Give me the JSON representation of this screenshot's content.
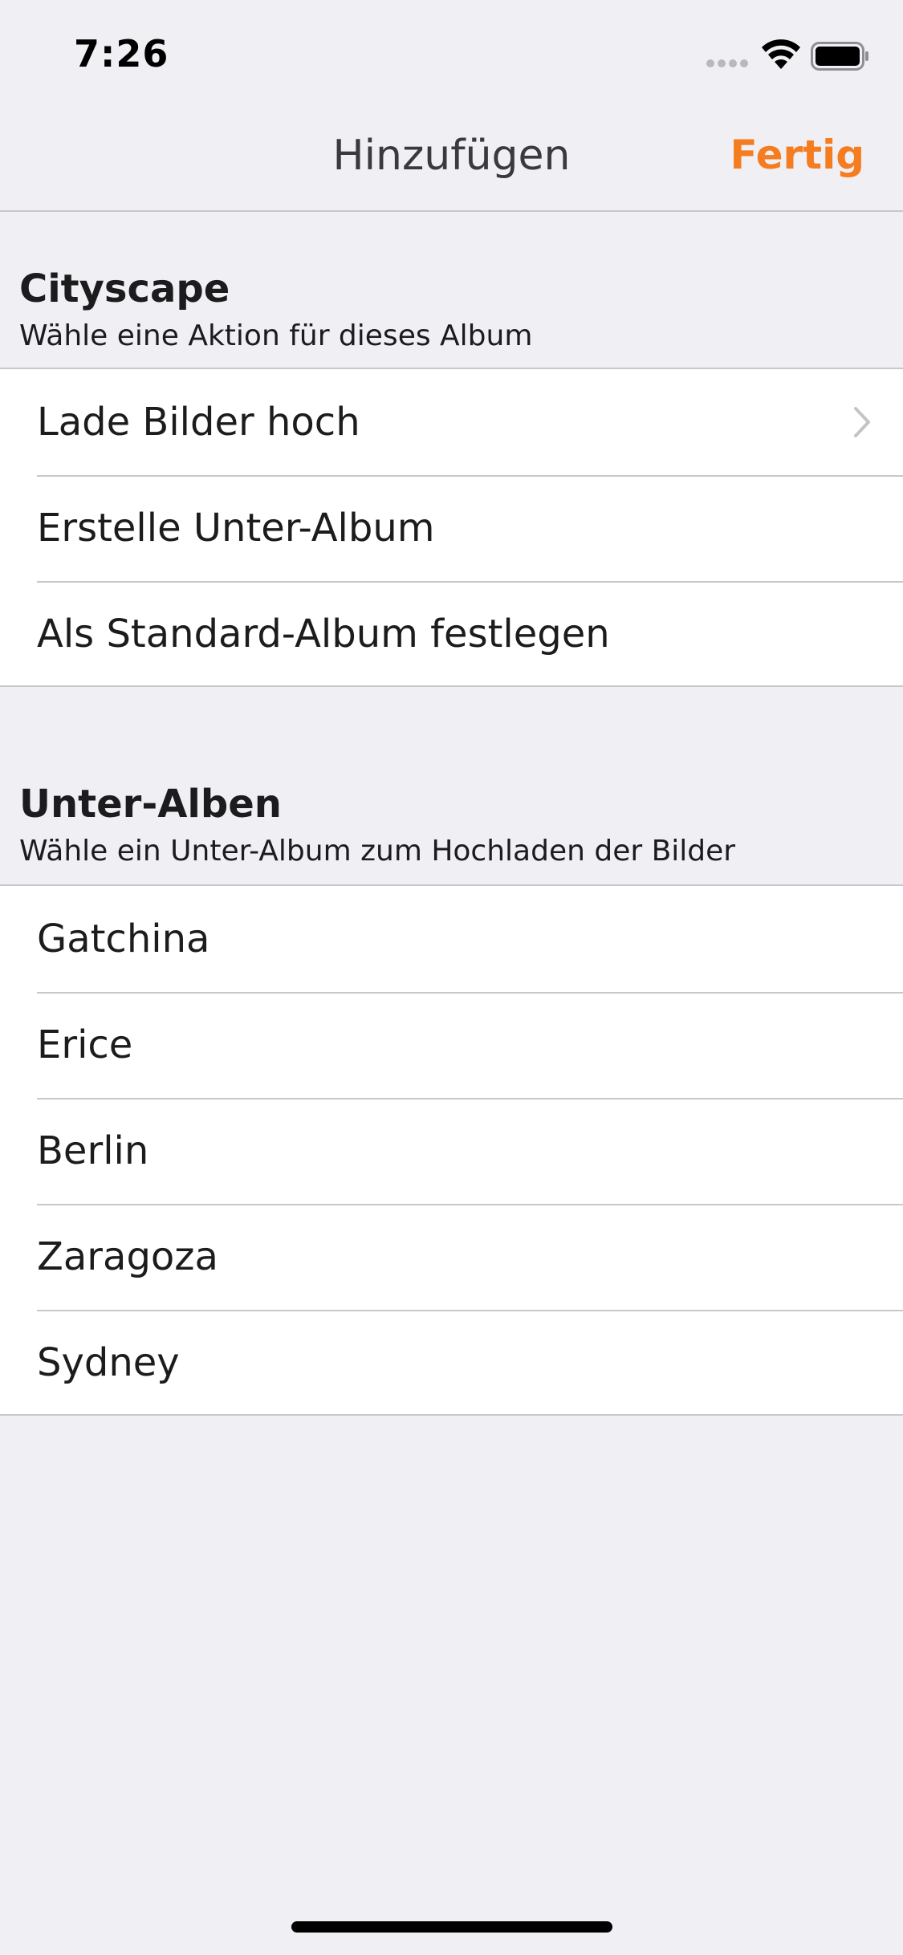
{
  "status_bar": {
    "time": "7:26"
  },
  "nav": {
    "title": "Hinzufügen",
    "done_label": "Fertig",
    "accent_color": "#F57C1F"
  },
  "album_section": {
    "title": "Cityscape",
    "subtitle": "Wähle eine Aktion für dieses Album",
    "rows": [
      {
        "label": "Lade Bilder hoch",
        "icon": "chevron-right-icon"
      },
      {
        "label": "Erstelle Unter-Album"
      },
      {
        "label": "Als Standard-Album festlegen"
      }
    ]
  },
  "subalbums_section": {
    "title": "Unter-Alben",
    "subtitle": "Wähle ein Unter-Album zum Hochladen der Bilder",
    "rows": [
      {
        "label": "Gatchina"
      },
      {
        "label": "Erice"
      },
      {
        "label": "Berlin"
      },
      {
        "label": "Zaragoza"
      },
      {
        "label": "Sydney"
      }
    ]
  }
}
